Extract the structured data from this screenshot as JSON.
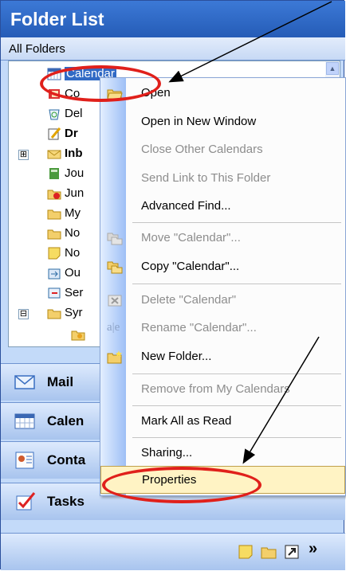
{
  "header": {
    "title": "Folder List"
  },
  "subheader": {
    "label": "All Folders"
  },
  "tree": {
    "items": [
      {
        "label": "Calendar",
        "icon": "calendar-icon",
        "selected": true
      },
      {
        "label": "Co",
        "icon": "contacts-icon"
      },
      {
        "label": "Del",
        "icon": "deleted-items-icon"
      },
      {
        "label": "Dr",
        "icon": "drafts-icon",
        "bold": true
      },
      {
        "label": "Inb",
        "icon": "inbox-icon",
        "bold": true
      },
      {
        "label": "Jou",
        "icon": "journal-icon"
      },
      {
        "label": "Jun",
        "icon": "junk-icon"
      },
      {
        "label": "My",
        "icon": "folder-icon"
      },
      {
        "label": "No",
        "icon": "folder-icon"
      },
      {
        "label": "No",
        "icon": "notes-icon"
      },
      {
        "label": "Ou",
        "icon": "outbox-icon"
      },
      {
        "label": "Ser",
        "icon": "sent-items-icon"
      },
      {
        "label": "Syr",
        "icon": "folder-icon"
      }
    ],
    "expanders": [
      "⊞",
      "⊟"
    ]
  },
  "nav": {
    "mail": "Mail",
    "calendar": "Calen",
    "contacts": "Conta",
    "tasks": "Tasks"
  },
  "menu": {
    "items": [
      {
        "label": "Open",
        "disabled": false
      },
      {
        "label": "Open in New Window",
        "disabled": false
      },
      {
        "label": "Close Other Calendars",
        "disabled": true
      },
      {
        "label": "Send Link to This Folder",
        "disabled": true
      },
      {
        "label": "Advanced Find...",
        "disabled": false
      },
      {
        "label": "Move \"Calendar\"...",
        "disabled": true
      },
      {
        "label": "Copy \"Calendar\"...",
        "disabled": false
      },
      {
        "label": "Delete \"Calendar\"",
        "disabled": true
      },
      {
        "label": "Rename \"Calendar\"...",
        "disabled": true
      },
      {
        "label": "New Folder...",
        "disabled": false
      },
      {
        "label": "Remove from My Calendars",
        "disabled": true
      },
      {
        "label": "Mark All as Read",
        "disabled": false
      },
      {
        "label": "Sharing...",
        "disabled": false
      },
      {
        "label": "Properties",
        "disabled": false,
        "highlighted": true
      }
    ]
  },
  "bottombar": {
    "chevron": "»"
  },
  "colors": {
    "header_blue": "#255cb7",
    "selection_blue": "#316ac5",
    "highlight_annotation": "#e0201b",
    "menu_hover": "#fff3c4"
  }
}
